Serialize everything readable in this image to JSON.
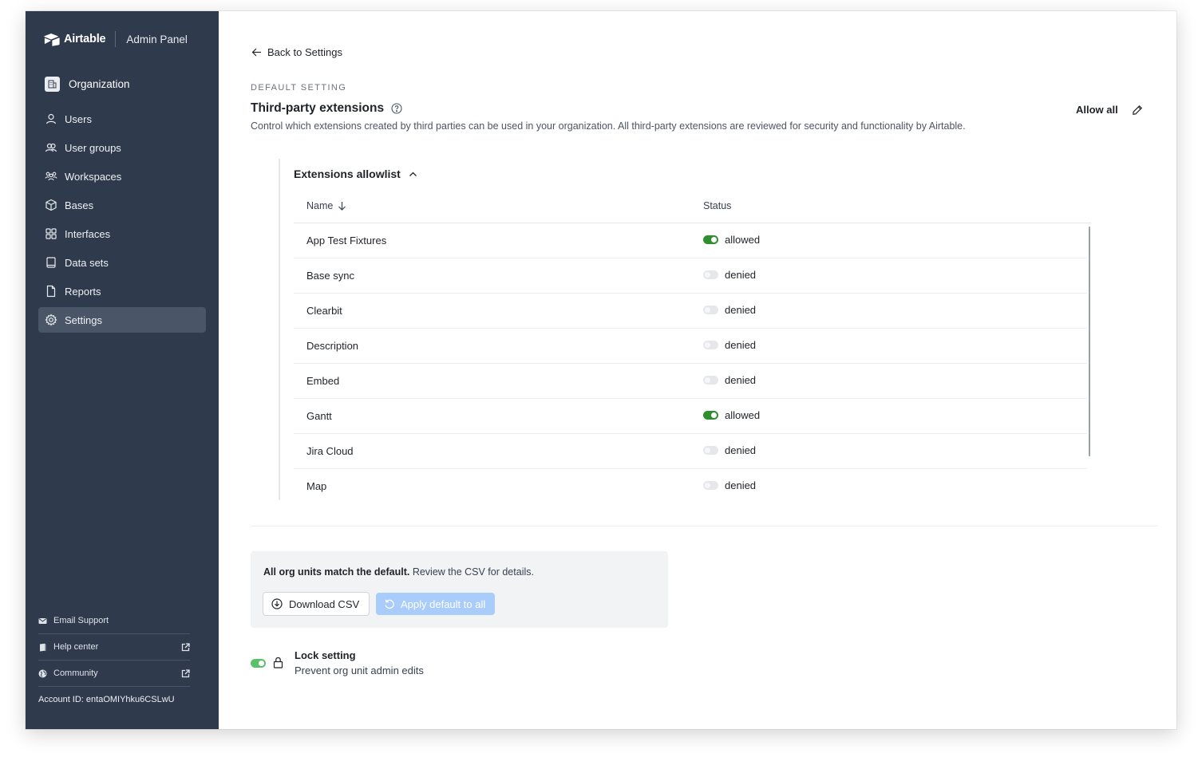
{
  "sidebar": {
    "brand": "Airtable",
    "panel": "Admin Panel",
    "org": "Organization",
    "items": [
      {
        "label": "Users",
        "icon": "user-icon"
      },
      {
        "label": "User groups",
        "icon": "user-groups-icon"
      },
      {
        "label": "Workspaces",
        "icon": "workspaces-icon"
      },
      {
        "label": "Bases",
        "icon": "cube-icon"
      },
      {
        "label": "Interfaces",
        "icon": "grid-icon"
      },
      {
        "label": "Data sets",
        "icon": "dataset-icon"
      },
      {
        "label": "Reports",
        "icon": "document-icon"
      },
      {
        "label": "Settings",
        "icon": "gear-icon",
        "active": true
      }
    ],
    "footer": {
      "email_support": "Email Support",
      "help_center": "Help center",
      "community": "Community",
      "account": "Account ID:  entaOMIYhku6CSLwU"
    }
  },
  "main": {
    "back": "Back to Settings",
    "eyebrow": "DEFAULT SETTING",
    "title": "Third-party extensions",
    "description": "Control which extensions created by third parties can be used in your organization. All third-party extensions are reviewed for security and functionality by Airtable.",
    "allow_all": "Allow all",
    "allowlist": {
      "title": "Extensions allowlist",
      "columns": {
        "name": "Name",
        "status": "Status"
      },
      "rows": [
        {
          "name": "App Test Fixtures",
          "status": "allowed",
          "on": true
        },
        {
          "name": "Base sync",
          "status": "denied",
          "on": false
        },
        {
          "name": "Clearbit",
          "status": "denied",
          "on": false
        },
        {
          "name": "Description",
          "status": "denied",
          "on": false
        },
        {
          "name": "Embed",
          "status": "denied",
          "on": false
        },
        {
          "name": "Gantt",
          "status": "allowed",
          "on": true
        },
        {
          "name": "Jira Cloud",
          "status": "denied",
          "on": false
        },
        {
          "name": "Map",
          "status": "denied",
          "on": false
        }
      ]
    },
    "notice": {
      "bold": "All org units match the default.",
      "rest": " Review the CSV for details.",
      "download": "Download CSV",
      "apply": "Apply default to all"
    },
    "lock": {
      "title": "Lock setting",
      "subtitle": "Prevent org unit admin edits",
      "enabled": true
    }
  },
  "colors": {
    "sidebar_bg": "#2f3a4c",
    "toggle_on": "#2f8f2f",
    "apply_button": "#a9ccfb"
  }
}
